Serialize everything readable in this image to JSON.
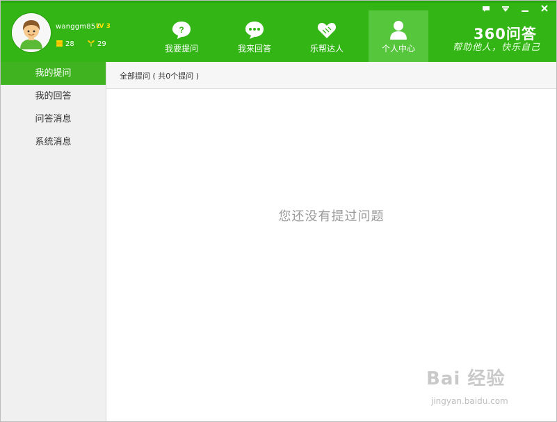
{
  "user": {
    "name": "wanggm857",
    "level": "LV 3",
    "coins": "28",
    "answers": "29"
  },
  "nav": [
    {
      "label": "我要提问",
      "icon": "question-bubble-icon"
    },
    {
      "label": "我来回答",
      "icon": "chat-bubble-icon"
    },
    {
      "label": "乐帮达人",
      "icon": "heart-hands-icon"
    },
    {
      "label": "个人中心",
      "icon": "person-icon",
      "active": true
    }
  ],
  "brand": {
    "logo": "360问答",
    "slogan": "帮助他人，快乐自己"
  },
  "window_controls": [
    "chat-icon",
    "menu-icon",
    "minimize-icon",
    "close-icon"
  ],
  "sidebar": {
    "items": [
      {
        "label": "我的提问",
        "active": true
      },
      {
        "label": "我的回答"
      },
      {
        "label": "问答消息"
      },
      {
        "label": "系统消息"
      }
    ]
  },
  "main": {
    "breadcrumb": "全部提问 ( 共0个提问 )",
    "empty_message": "您还没有提过问题"
  },
  "watermark": {
    "logo": "Bai 经验",
    "url": "jingyan.baidu.com"
  },
  "colors": {
    "header": "#32b515",
    "active_sidebar": "#3fb320",
    "level": "#ffe100"
  }
}
